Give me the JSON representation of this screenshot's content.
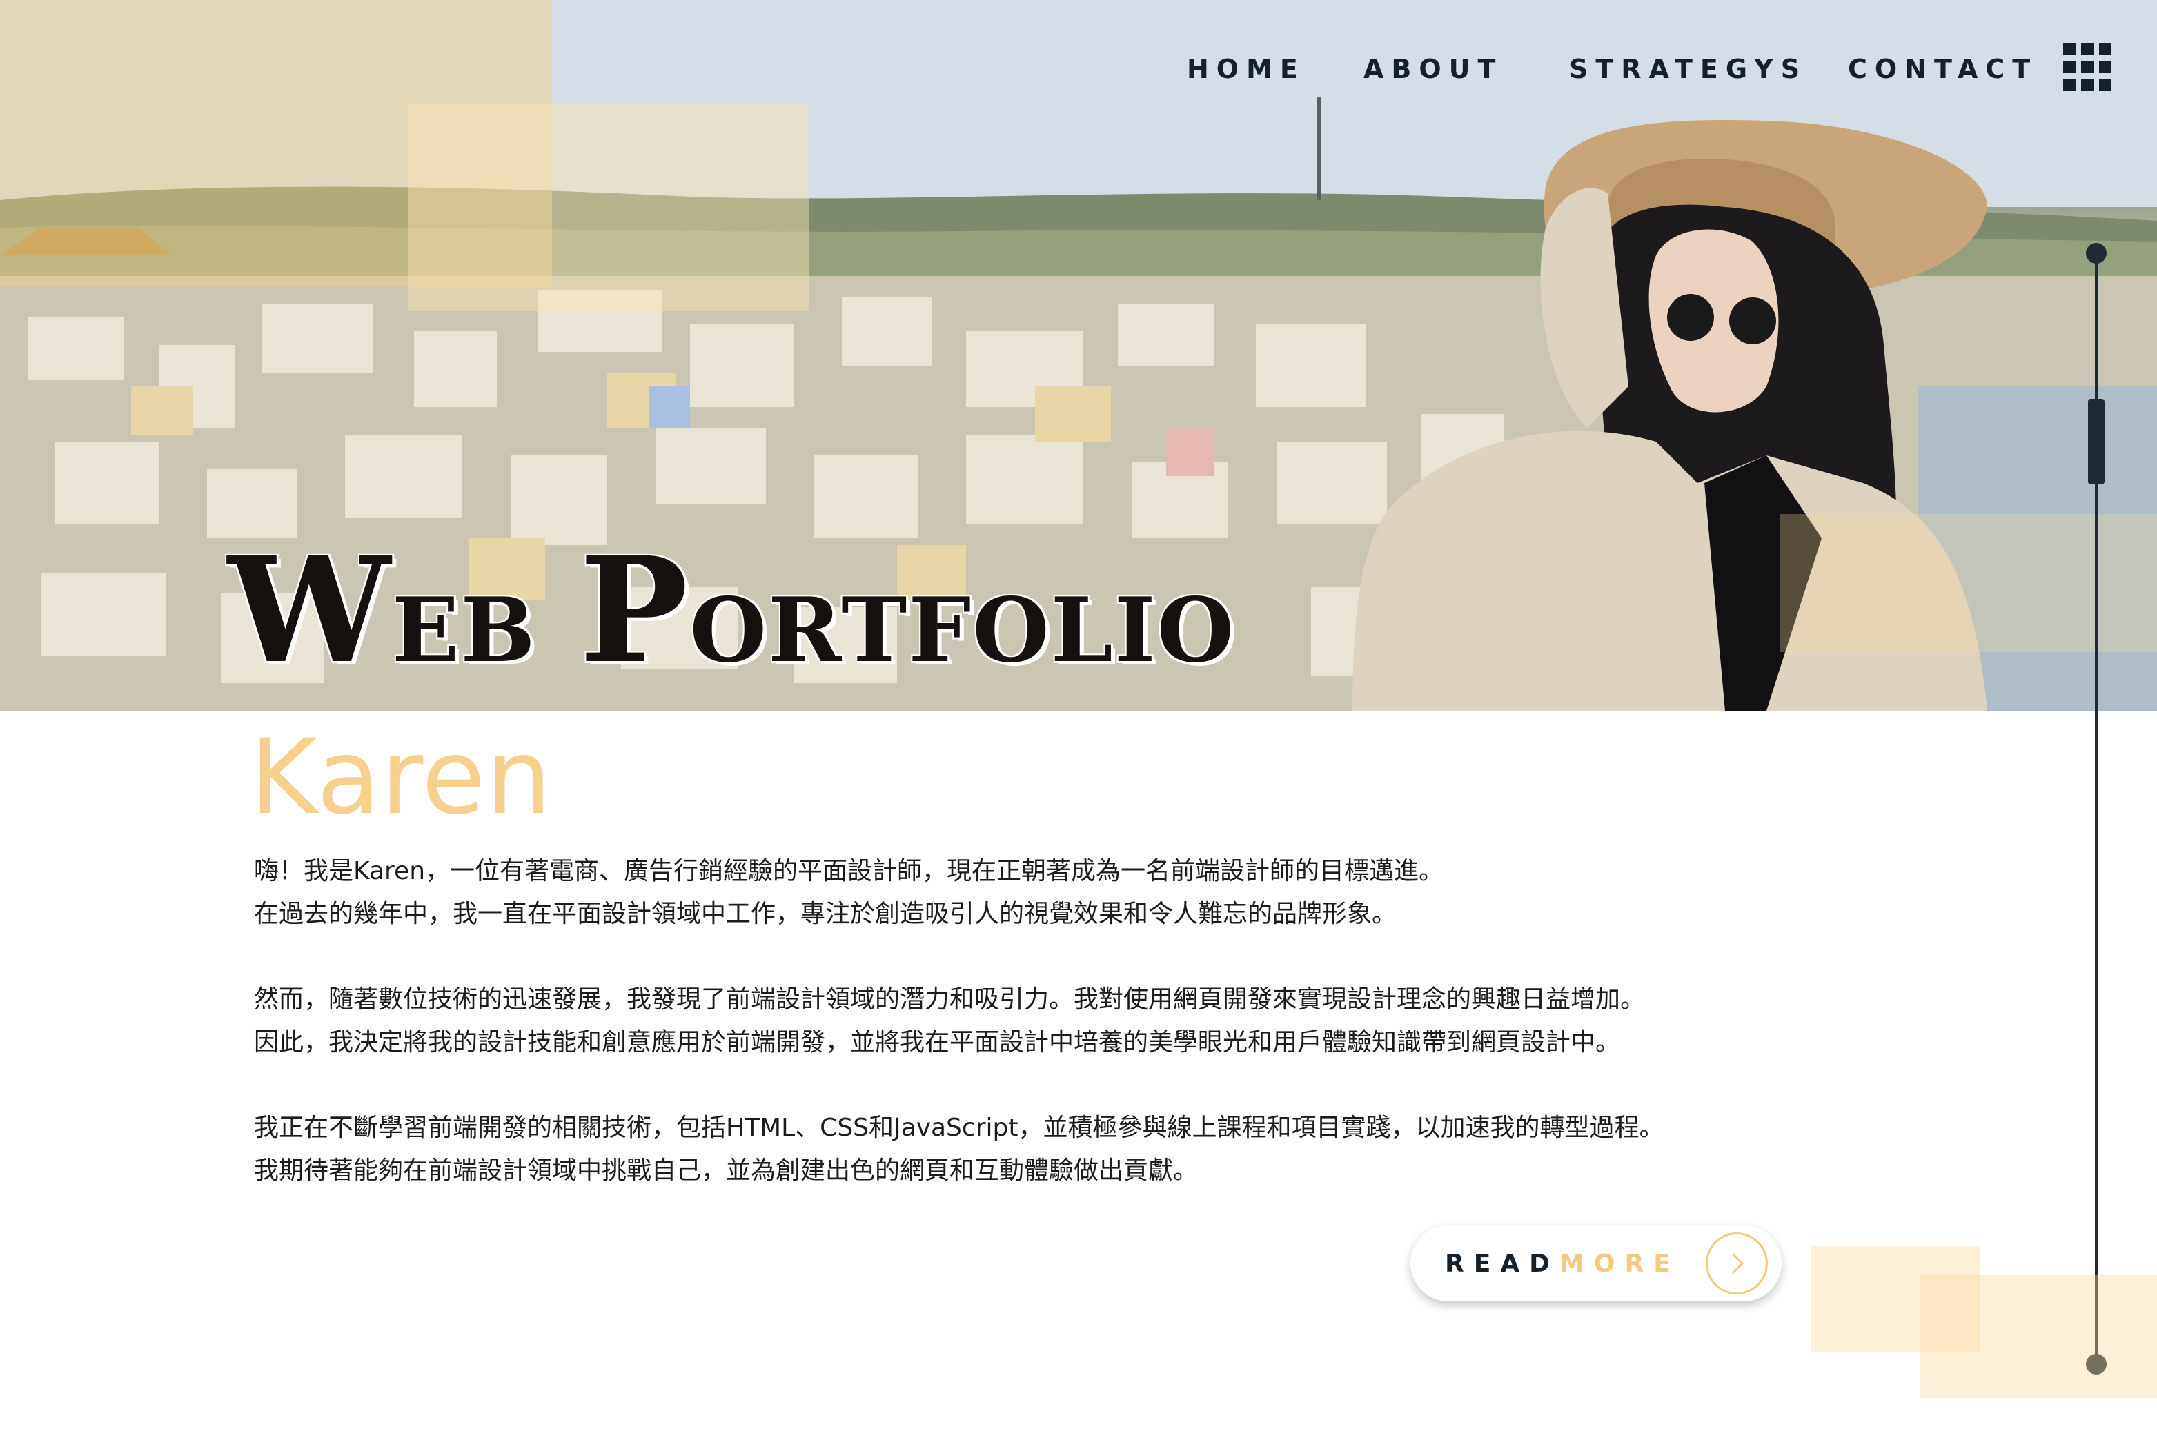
{
  "nav": {
    "items": [
      {
        "label": "HOME"
      },
      {
        "label": "ABOUT"
      },
      {
        "label": "STRATEGYS"
      },
      {
        "label": "CONTACT"
      }
    ],
    "menu_icon": "grid-menu-icon"
  },
  "hero": {
    "title_initial_1": "W",
    "title_rest_1": "EB",
    "title_initial_2": "P",
    "title_rest_2": "ORTFOLIO"
  },
  "profile": {
    "name": "Karen",
    "paragraphs": [
      "嗨！我是Karen，一位有著電商、廣告行銷經驗的平面設計師，現在正朝著成為一名前端設計師的目標邁進。",
      "在過去的幾年中，我一直在平面設計領域中工作，專注於創造吸引人的視覺效果和令人難忘的品牌形象。",
      "然而，隨著數位技術的迅速發展，我發現了前端設計領域的潛力和吸引力。我對使用網頁開發來實現設計理念的興趣日益增加。",
      "因此，我決定將我的設計技能和創意應用於前端開發，並將我在平面設計中培養的美學眼光和用戶體驗知識帶到網頁設計中。",
      "我正在不斷學習前端開發的相關技術，包括HTML、CSS和JavaScript，並積極參與線上課程和項目實踐，以加速我的轉型過程。",
      "我期待著能夠在前端設計領域中挑戰自己，並為創建出色的網頁和互動體驗做出貢獻。"
    ]
  },
  "read_more": {
    "label_part1": "READ",
    "label_part2": "MORE",
    "icon": "chevron-right-icon"
  },
  "colors": {
    "accent": "#f5c97e",
    "name": "#f7d08e",
    "dark": "#14202b"
  }
}
